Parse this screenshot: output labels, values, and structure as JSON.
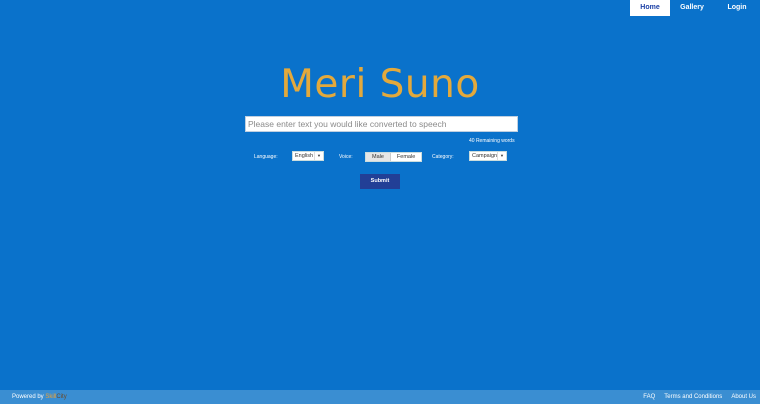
{
  "nav": {
    "home": "Home",
    "gallery": "Gallery",
    "login": "Login"
  },
  "logo": "Meri Suno",
  "input": {
    "placeholder": "Please enter text you would like converted to speech",
    "value": ""
  },
  "remaining": "40 Remaining words",
  "options": {
    "language_label": "Language:",
    "language_value": "English",
    "voice_label": "Voice:",
    "voice_male": "Male",
    "voice_female": "Female",
    "voice_selected": "Male",
    "category_label": "Category:",
    "category_value": "Campaign"
  },
  "submit_label": "Submit",
  "footer": {
    "powered_prefix": "Powered by",
    "brand_part1": "Skill",
    "brand_part2": "City",
    "links": [
      "FAQ",
      "Terms and Conditions",
      "About Us"
    ]
  },
  "colors": {
    "background": "#0a72cb",
    "accent": "#e3a93c",
    "button": "#223f96",
    "footer": "#3a8ed2"
  }
}
